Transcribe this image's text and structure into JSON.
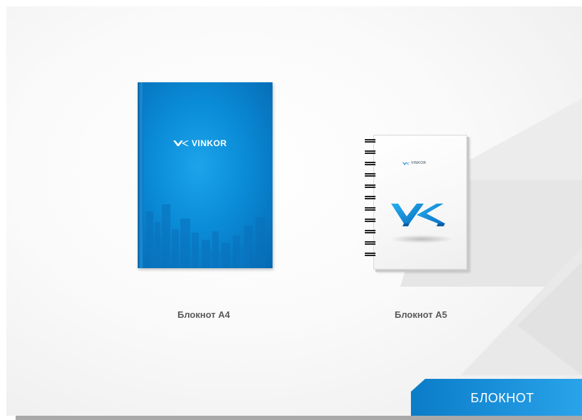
{
  "notebook_a4": {
    "brand": "VINKOR",
    "caption": "Блокнот А4"
  },
  "notebook_a5": {
    "brand": "VINKOR",
    "caption": "Блокнот А5"
  },
  "corner_tag": {
    "label": "БЛОКНОТ"
  },
  "colors": {
    "brand_blue": "#0a8bd6",
    "tag_blue": "#1a8fd8",
    "caption_gray": "#5a5a5a"
  },
  "icons": [
    "vk-logo-icon",
    "spiral-binding-icon"
  ]
}
